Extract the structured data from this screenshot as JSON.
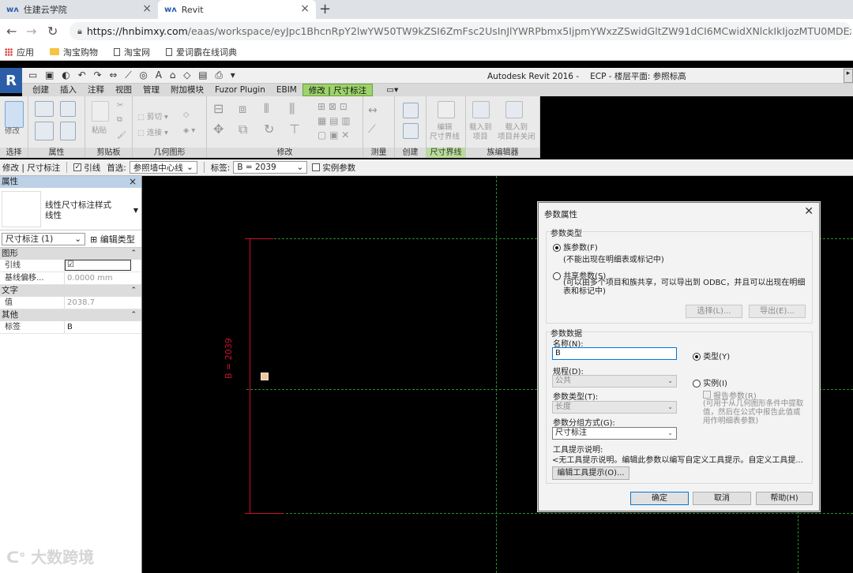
{
  "browser": {
    "tabs": [
      {
        "title": "住建云学院",
        "active": false
      },
      {
        "title": "Revit",
        "active": true
      }
    ],
    "url_host": "https://hnbimxy.com",
    "url_path": "/eaas/workspace/eyJpc1BhcnRpY2lwYW50TW9kZSI6ZmFsc2UsInJlYWRPbmx5IjpmYWxzZSwidGltZW91dCI6MCwidXNlckIkIjozMTU0MDEzNzIzMDM1NjQ4L",
    "bookmarks": [
      "应用",
      "淘宝购物",
      "淘宝网",
      "爱词霸在线词典"
    ]
  },
  "revit": {
    "app_title": "Autodesk Revit 2016 -",
    "doc_title": "ECP - 楼层平面: 参照标高",
    "ribbon_tabs": [
      "创建",
      "插入",
      "注释",
      "视图",
      "管理",
      "附加模块",
      "Fuzor Plugin",
      "EBIM",
      "修改 | 尺寸标注"
    ],
    "panels": [
      "选择",
      "属性",
      "剪贴板",
      "几何图形",
      "修改",
      "测量",
      "创建",
      "尺寸界线",
      "族编辑器"
    ],
    "ribbon_buttons": {
      "modify": "修改",
      "paste": "粘贴",
      "cut": "剪切",
      "join": "连接",
      "edit_witness": "编辑\n尺寸界线",
      "load_project": "载入到\n项目",
      "load_close": "载入到\n项目并关闭"
    },
    "options_bar": {
      "context": "修改 | 尺寸标注",
      "leader_label": "引线",
      "prefer_label": "首选:",
      "prefer_value": "参照墙中心线",
      "tag_label": "标签:",
      "tag_value": "B = 2039",
      "instance_param": "实例参数"
    },
    "properties": {
      "header": "属性",
      "type_name_line1": "线性尺寸标注样式",
      "type_name_line2": "线性",
      "instance_selector": "尺寸标注 (1)",
      "edit_type": "编辑类型",
      "groups": [
        {
          "name": "图形",
          "rows": [
            {
              "key": "引线",
              "value": "☑"
            },
            {
              "key": "基线偏移...",
              "value": "0.0000 mm"
            }
          ]
        },
        {
          "name": "文字",
          "rows": [
            {
              "key": "值",
              "value": "2038.7"
            }
          ]
        },
        {
          "name": "其他",
          "rows": [
            {
              "key": "标签",
              "value": "B"
            }
          ]
        }
      ]
    },
    "canvas": {
      "dimension_text": "B = 2039"
    }
  },
  "dialog": {
    "title": "参数属性",
    "param_type_group": "参数类型",
    "family_param": "族参数(F)",
    "family_param_note": "(不能出现在明细表或标记中)",
    "shared_param": "共享参数(S)",
    "shared_param_note": "(可以由多个项目和族共享，可以导出到 ODBC，并且可以出现在明细表和标记中)",
    "select_btn": "选择(L)...",
    "export_btn": "导出(E)...",
    "param_data_group": "参数数据",
    "name_label": "名称(N):",
    "name_value": "B",
    "type_radio": "类型(Y)",
    "instance_radio": "实例(I)",
    "report_param": "报告参数(R)",
    "report_note": "(可用于从几何图形条件中提取值，然后在公式中报告此值或用作明细表参数)",
    "discipline_label": "规程(D):",
    "discipline_value": "公共",
    "ptype_label": "参数类型(T):",
    "ptype_value": "长度",
    "group_label": "参数分组方式(G):",
    "group_value": "尺寸标注",
    "tooltip_label": "工具提示说明:",
    "tooltip_value": "<无工具提示说明。编辑此参数以编写自定义工具提示。自定义工具提...",
    "edit_tooltip_btn": "编辑工具提示(O)...",
    "ok": "确定",
    "cancel": "取消",
    "help": "帮助(H)"
  },
  "watermark": "大数跨境"
}
